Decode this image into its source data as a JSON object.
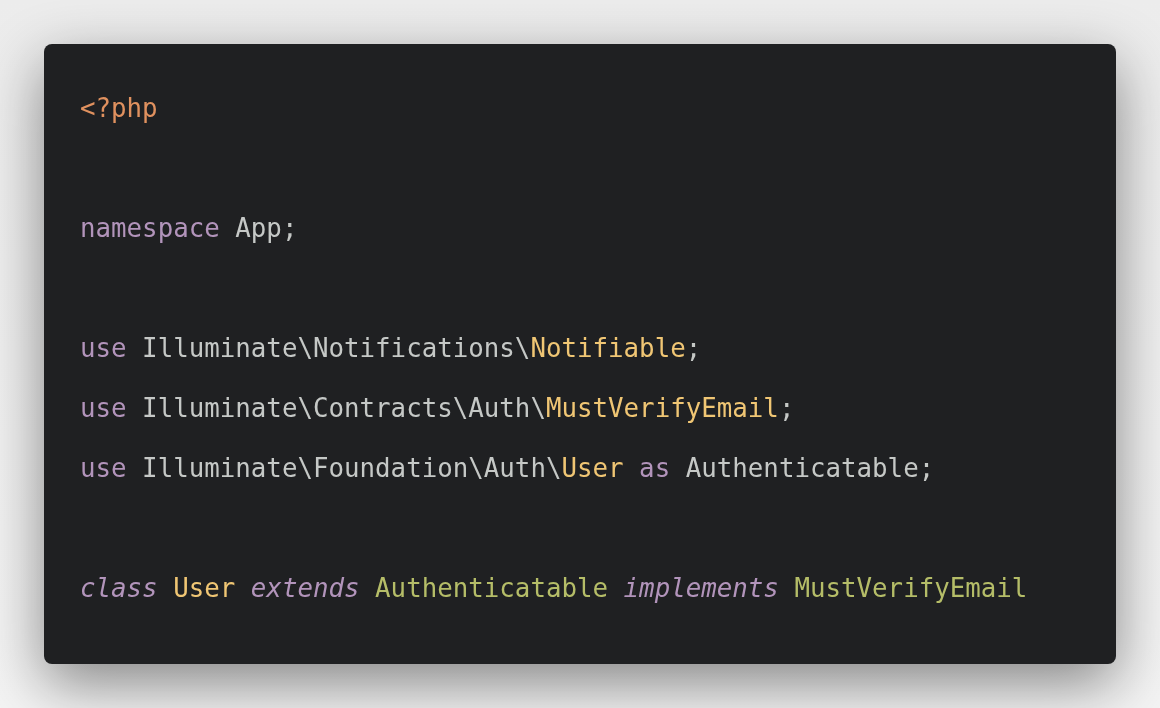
{
  "code_lines": [
    {
      "kind": "code",
      "tokens": [
        {
          "text": "<?php",
          "kind": "tag"
        }
      ]
    },
    {
      "kind": "blank"
    },
    {
      "kind": "code",
      "tokens": [
        {
          "text": "namespace",
          "kind": "keyword"
        },
        {
          "text": " App;",
          "kind": "plain"
        }
      ]
    },
    {
      "kind": "blank"
    },
    {
      "kind": "code",
      "tokens": [
        {
          "text": "use",
          "kind": "keyword"
        },
        {
          "text": " Illuminate\\Notifications\\",
          "kind": "plain"
        },
        {
          "text": "Notifiable",
          "kind": "class"
        },
        {
          "text": ";",
          "kind": "plain"
        }
      ]
    },
    {
      "kind": "code",
      "tokens": [
        {
          "text": "use",
          "kind": "keyword"
        },
        {
          "text": " Illuminate\\Contracts\\Auth\\",
          "kind": "plain"
        },
        {
          "text": "MustVerifyEmail",
          "kind": "class"
        },
        {
          "text": ";",
          "kind": "plain"
        }
      ]
    },
    {
      "kind": "code",
      "tokens": [
        {
          "text": "use",
          "kind": "keyword"
        },
        {
          "text": " Illuminate\\Foundation\\Auth\\",
          "kind": "plain"
        },
        {
          "text": "User",
          "kind": "class"
        },
        {
          "text": " as",
          "kind": "keyword"
        },
        {
          "text": " Authenticatable;",
          "kind": "plain"
        }
      ]
    },
    {
      "kind": "blank"
    },
    {
      "kind": "code",
      "tokens": [
        {
          "text": "class",
          "kind": "storage"
        },
        {
          "text": " User",
          "kind": "class"
        },
        {
          "text": " extends",
          "kind": "storage"
        },
        {
          "text": " Authenticatable",
          "kind": "type"
        },
        {
          "text": " implements",
          "kind": "storage"
        },
        {
          "text": " MustVerifyEmail",
          "kind": "type"
        }
      ]
    }
  ]
}
